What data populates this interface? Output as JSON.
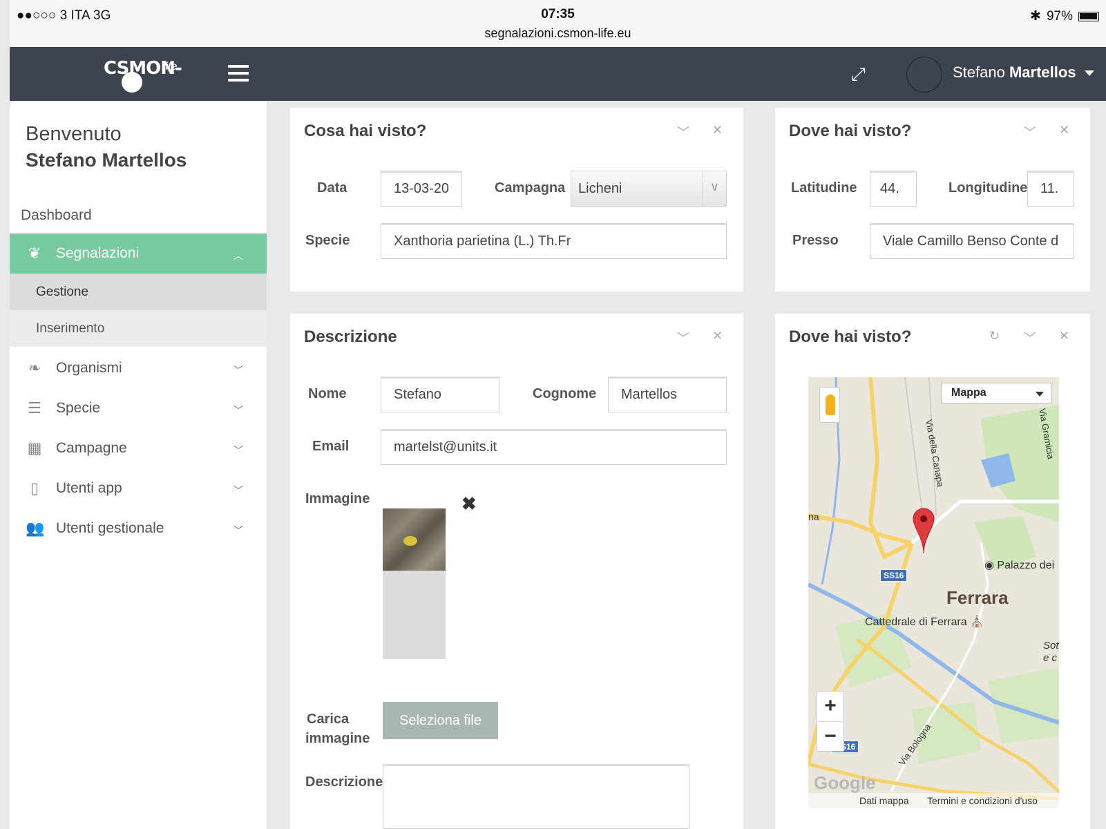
{
  "status_bar": {
    "carrier": "●●○○○ 3 ITA   3G",
    "time": "07:35",
    "url": "segnalazioni.csmon-life.eu",
    "battery": "97%"
  },
  "header": {
    "logo_text": "CSMON-",
    "logo_sub": "life",
    "user_first": "Stefano",
    "user_last": "Martellos"
  },
  "sidebar": {
    "welcome": "Benvenuto",
    "name": "Stefano Martellos",
    "dashboard": "Dashboard",
    "items": [
      {
        "label": "Segnalazioni",
        "icon": "leaf-bug-icon"
      },
      {
        "label": "Organismi",
        "icon": "leaf-icon"
      },
      {
        "label": "Specie",
        "icon": "list-icon"
      },
      {
        "label": "Campagne",
        "icon": "grid-icon"
      },
      {
        "label": "Utenti app",
        "icon": "mobile-icon"
      },
      {
        "label": "Utenti gestionale",
        "icon": "users-icon"
      }
    ],
    "sub_items": [
      {
        "label": "Gestione"
      },
      {
        "label": "Inserimento"
      }
    ]
  },
  "panel_what": {
    "title": "Cosa hai visto?",
    "data_label": "Data",
    "data_value": "13-03-20",
    "campagna_label": "Campagna",
    "campagna_value": "Licheni",
    "specie_label": "Specie",
    "specie_value": "Xanthoria parietina (L.) Th.Fr"
  },
  "panel_where": {
    "title": "Dove hai visto?",
    "lat_label": "Latitudine",
    "lat_value": "44.",
    "lon_label": "Longitudine",
    "lon_value": "11.",
    "presso_label": "Presso",
    "presso_value": "Viale Camillo Benso Conte d"
  },
  "panel_desc": {
    "title": "Descrizione",
    "nome_label": "Nome",
    "nome_value": "Stefano",
    "cognome_label": "Cognome",
    "cognome_value": "Martellos",
    "email_label": "Email",
    "email_value": "martelst@units.it",
    "immagine_label": "Immagine",
    "carica_label_1": "Carica",
    "carica_label_2": "immagine",
    "file_button": "Seleziona file",
    "descrizione_label": "Descrizione"
  },
  "panel_map": {
    "title": "Dove hai visto?",
    "map_type": "Mappa",
    "city": "Ferrara",
    "poi_1": "Palazzo dei",
    "poi_2": "Cattedrale di Ferrara",
    "street_1": "Via della Canapa",
    "street_2": "Via Gramicia",
    "street_3": "Via Bologna",
    "road_1": "SS16",
    "road_2": "SS16",
    "edge_1": "Sot",
    "edge_2": "e c",
    "edge_3": "na",
    "footer_data": "Dati mappa",
    "footer_terms": "Termini e condizioni d'uso",
    "google": "Google"
  },
  "colors": {
    "nav_bg": "#3d4450",
    "active_green": "#77c9a0",
    "file_button": "#a8b5b2"
  }
}
